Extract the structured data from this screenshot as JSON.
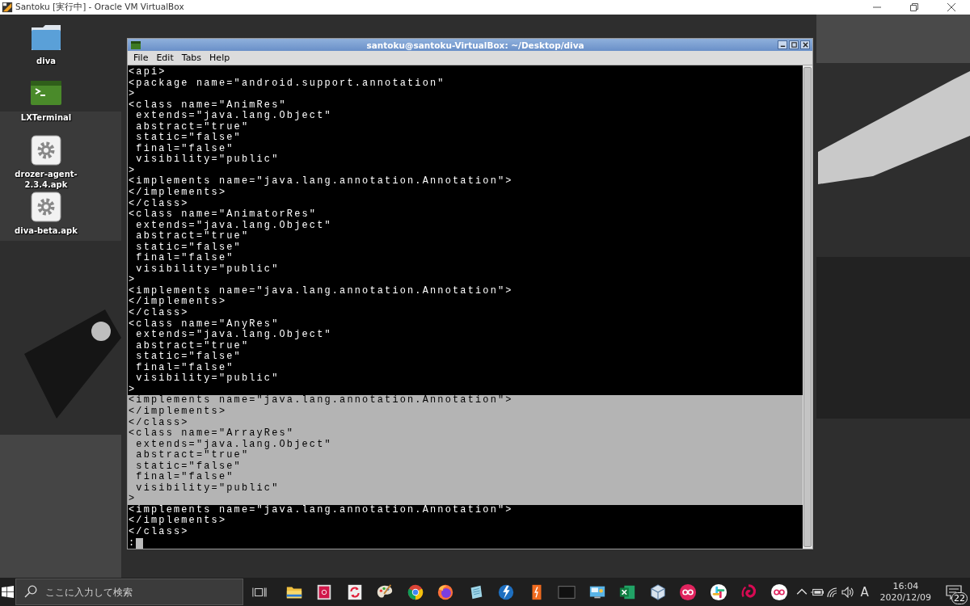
{
  "host_window": {
    "title": "Santoku [実行中] - Oracle VM VirtualBox"
  },
  "desktop_icons": [
    {
      "label": "diva",
      "kind": "folder"
    },
    {
      "label": "LXTerminal",
      "kind": "terminal"
    },
    {
      "label": "drozer-agent-2.3.4.apk",
      "kind": "package"
    },
    {
      "label": "diva-beta.apk",
      "kind": "package"
    }
  ],
  "terminal": {
    "title": "santoku@santoku-VirtualBox: ~/Desktop/diva",
    "menu": [
      "File",
      "Edit",
      "Tabs",
      "Help"
    ],
    "lines": [
      {
        "text": "<api>",
        "selected": false
      },
      {
        "text": "<package name=\"android.support.annotation\"",
        "selected": false
      },
      {
        "text": ">",
        "selected": false
      },
      {
        "text": "<class name=\"AnimRes\"",
        "selected": false
      },
      {
        "text": " extends=\"java.lang.Object\"",
        "selected": false
      },
      {
        "text": " abstract=\"true\"",
        "selected": false
      },
      {
        "text": " static=\"false\"",
        "selected": false
      },
      {
        "text": " final=\"false\"",
        "selected": false
      },
      {
        "text": " visibility=\"public\"",
        "selected": false
      },
      {
        "text": ">",
        "selected": false
      },
      {
        "text": "<implements name=\"java.lang.annotation.Annotation\">",
        "selected": false
      },
      {
        "text": "</implements>",
        "selected": false
      },
      {
        "text": "</class>",
        "selected": false
      },
      {
        "text": "<class name=\"AnimatorRes\"",
        "selected": false
      },
      {
        "text": " extends=\"java.lang.Object\"",
        "selected": false
      },
      {
        "text": " abstract=\"true\"",
        "selected": false
      },
      {
        "text": " static=\"false\"",
        "selected": false
      },
      {
        "text": " final=\"false\"",
        "selected": false
      },
      {
        "text": " visibility=\"public\"",
        "selected": false
      },
      {
        "text": ">",
        "selected": false
      },
      {
        "text": "<implements name=\"java.lang.annotation.Annotation\">",
        "selected": false
      },
      {
        "text": "</implements>",
        "selected": false
      },
      {
        "text": "</class>",
        "selected": false
      },
      {
        "text": "<class name=\"AnyRes\"",
        "selected": false
      },
      {
        "text": " extends=\"java.lang.Object\"",
        "selected": false
      },
      {
        "text": " abstract=\"true\"",
        "selected": false
      },
      {
        "text": " static=\"false\"",
        "selected": false
      },
      {
        "text": " final=\"false\"",
        "selected": false
      },
      {
        "text": " visibility=\"public\"",
        "selected": false
      },
      {
        "text": ">",
        "selected": false
      },
      {
        "text": "<implements name=\"java.lang.annotation.Annotation\">",
        "selected": true
      },
      {
        "text": "</implements>",
        "selected": true
      },
      {
        "text": "</class>",
        "selected": true
      },
      {
        "text": "<class name=\"ArrayRes\"",
        "selected": true
      },
      {
        "text": " extends=\"java.lang.Object\"",
        "selected": true
      },
      {
        "text": " abstract=\"true\"",
        "selected": true
      },
      {
        "text": " static=\"false\"",
        "selected": true
      },
      {
        "text": " final=\"false\"",
        "selected": true
      },
      {
        "text": " visibility=\"public\"",
        "selected": true
      },
      {
        "text": ">",
        "selected": true
      },
      {
        "text": "<implements name=\"java.lang.annotation.Annotation\">",
        "selected": false
      },
      {
        "text": "</implements>",
        "selected": false
      },
      {
        "text": "</class>",
        "selected": false
      }
    ],
    "prompt": ":"
  },
  "taskbar": {
    "search": {
      "placeholder": "ここに入力して検索"
    },
    "apps": [
      {
        "kind": "explorer"
      },
      {
        "kind": "book"
      },
      {
        "kind": "sync"
      },
      {
        "kind": "paint"
      },
      {
        "kind": "chrome"
      },
      {
        "kind": "firefox"
      },
      {
        "kind": "notepad"
      },
      {
        "kind": "lightning"
      },
      {
        "kind": "orange"
      },
      {
        "kind": "terminal"
      },
      {
        "kind": "monitor"
      },
      {
        "kind": "excel"
      },
      {
        "kind": "cube"
      },
      {
        "kind": "rings"
      },
      {
        "kind": "slack"
      },
      {
        "kind": "swirl"
      },
      {
        "kind": "rings-light"
      }
    ],
    "ime": "A",
    "time": "16:04",
    "date": "2020/12/09",
    "notifications": "22"
  }
}
